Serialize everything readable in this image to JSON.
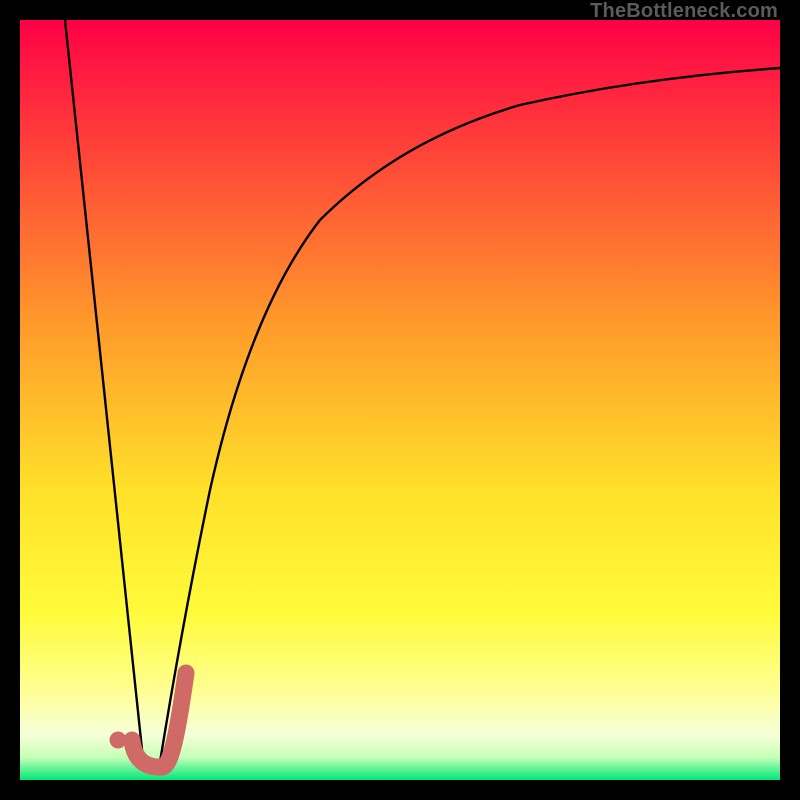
{
  "watermark": "TheBottleneck.com",
  "colors": {
    "frame": "#000000",
    "curve_stroke": "#000000",
    "accent_line": "#cf6a66",
    "accent_dot": "#cf6a67",
    "gradient": {
      "top": "#ff0046",
      "mid_upper": "#ff7a2c",
      "mid": "#ffe82b",
      "mid_lower": "#ffff7a",
      "lower": "#fbffd9",
      "bottom": "#00e877"
    }
  },
  "chart_data": {
    "type": "line",
    "title": "",
    "xlabel": "",
    "ylabel": "",
    "xlim": [
      0,
      100
    ],
    "ylim": [
      0,
      100
    ],
    "series": [
      {
        "name": "left-falling",
        "x": [
          6,
          8,
          10,
          12,
          14,
          16
        ],
        "values": [
          100,
          80,
          60,
          40,
          20,
          3
        ]
      },
      {
        "name": "right-rising",
        "x": [
          18,
          20,
          22,
          25,
          30,
          35,
          40,
          50,
          60,
          70,
          80,
          90,
          100
        ],
        "values": [
          2,
          10,
          22,
          35,
          52,
          63,
          70,
          79,
          84,
          87,
          89,
          90.5,
          91.5
        ]
      }
    ],
    "accent_segment": {
      "name": "j-curve",
      "points": [
        {
          "x": 14.5,
          "y": 5
        },
        {
          "x": 15.0,
          "y": 2.3
        },
        {
          "x": 16.5,
          "y": 1.7
        },
        {
          "x": 18.5,
          "y": 1.8
        },
        {
          "x": 19.8,
          "y": 3.5
        },
        {
          "x": 21.0,
          "y": 9
        },
        {
          "x": 21.7,
          "y": 14
        }
      ]
    },
    "accent_dot": {
      "x": 13.0,
      "y": 5.3
    }
  }
}
